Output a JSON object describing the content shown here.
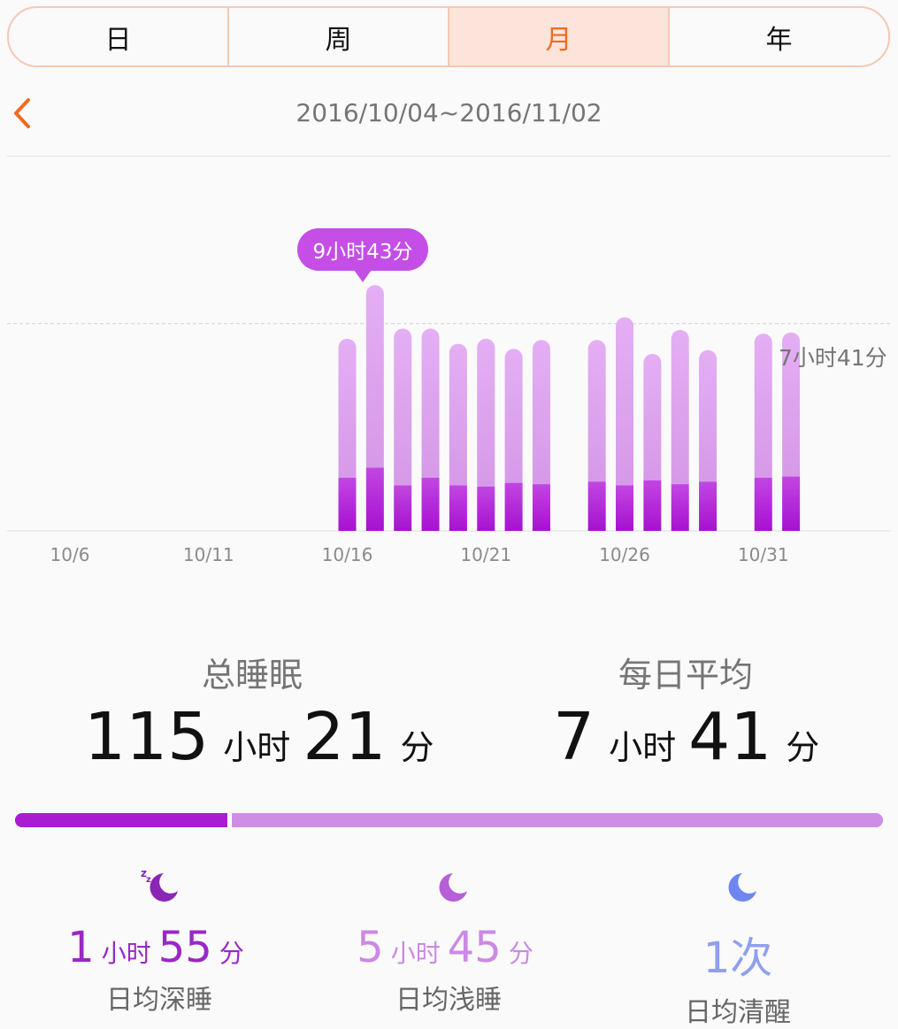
{
  "tabs": [
    {
      "label": "日"
    },
    {
      "label": "周"
    },
    {
      "label": "月",
      "active": true
    },
    {
      "label": "年"
    }
  ],
  "date_range": "2016/10/04~2016/11/02",
  "chart_data": {
    "type": "bar",
    "x_tick_labels": [
      "10/6",
      "10/11",
      "10/16",
      "10/21",
      "10/26",
      "10/31"
    ],
    "days": [
      "10/4",
      "10/5",
      "10/6",
      "10/7",
      "10/8",
      "10/9",
      "10/10",
      "10/11",
      "10/12",
      "10/13",
      "10/14",
      "10/15",
      "10/16",
      "10/17",
      "10/18",
      "10/19",
      "10/20",
      "10/21",
      "10/22",
      "10/23",
      "10/24",
      "10/25",
      "10/26",
      "10/27",
      "10/28",
      "10/29",
      "10/30",
      "10/31",
      "11/1",
      "11/2"
    ],
    "series": [
      {
        "name": "深睡",
        "color": "#b21cd6",
        "values_hours": [
          0,
          0,
          0,
          0,
          0,
          0,
          0,
          0,
          0,
          0,
          0,
          0,
          2.1,
          2.5,
          1.8,
          2.1,
          1.8,
          1.75,
          1.9,
          1.85,
          0,
          1.95,
          1.8,
          2.0,
          1.85,
          1.95,
          0,
          2.1,
          2.15,
          0
        ]
      },
      {
        "name": "浅睡",
        "color": "#e2a9f4",
        "values_hours": [
          0,
          0,
          0,
          0,
          0,
          0,
          0,
          0,
          0,
          0,
          0,
          0,
          5.5,
          7.22,
          6.2,
          5.9,
          5.6,
          5.85,
          5.3,
          5.7,
          0,
          5.6,
          6.65,
          5.0,
          6.1,
          5.2,
          0,
          5.7,
          5.7,
          0
        ]
      }
    ],
    "highlight": {
      "day": "10/17",
      "label": "9小时43分"
    },
    "average_line": {
      "value_hours": 8.2,
      "label": "7小时41分"
    },
    "ylim_hours": [
      0,
      10.5
    ]
  },
  "stats": {
    "total": {
      "title": "总睡眠",
      "hours": "115",
      "hours_unit": "小时",
      "minutes": "21",
      "minutes_unit": "分"
    },
    "average": {
      "title": "每日平均",
      "hours": "7",
      "hours_unit": "小时",
      "minutes": "41",
      "minutes_unit": "分"
    }
  },
  "ratio_bar": {
    "deep_fraction": 0.245,
    "deep_color": "#a81cd2",
    "light_color": "#cf8ee6"
  },
  "metrics": [
    {
      "icon": "deep-sleep-moon-icon",
      "color": "#9a27c6",
      "value": "1",
      "unit1": "小时",
      "value2": "55",
      "unit2": "分",
      "label": "日均深睡"
    },
    {
      "icon": "light-sleep-moon-icon",
      "color": "#cc88e6",
      "value": "5",
      "unit1": "小时",
      "value2": "45",
      "unit2": "分",
      "label": "日均浅睡"
    },
    {
      "icon": "awake-moon-icon",
      "color": "#8fa0f0",
      "value": "1次",
      "label": "日均清醒"
    }
  ]
}
